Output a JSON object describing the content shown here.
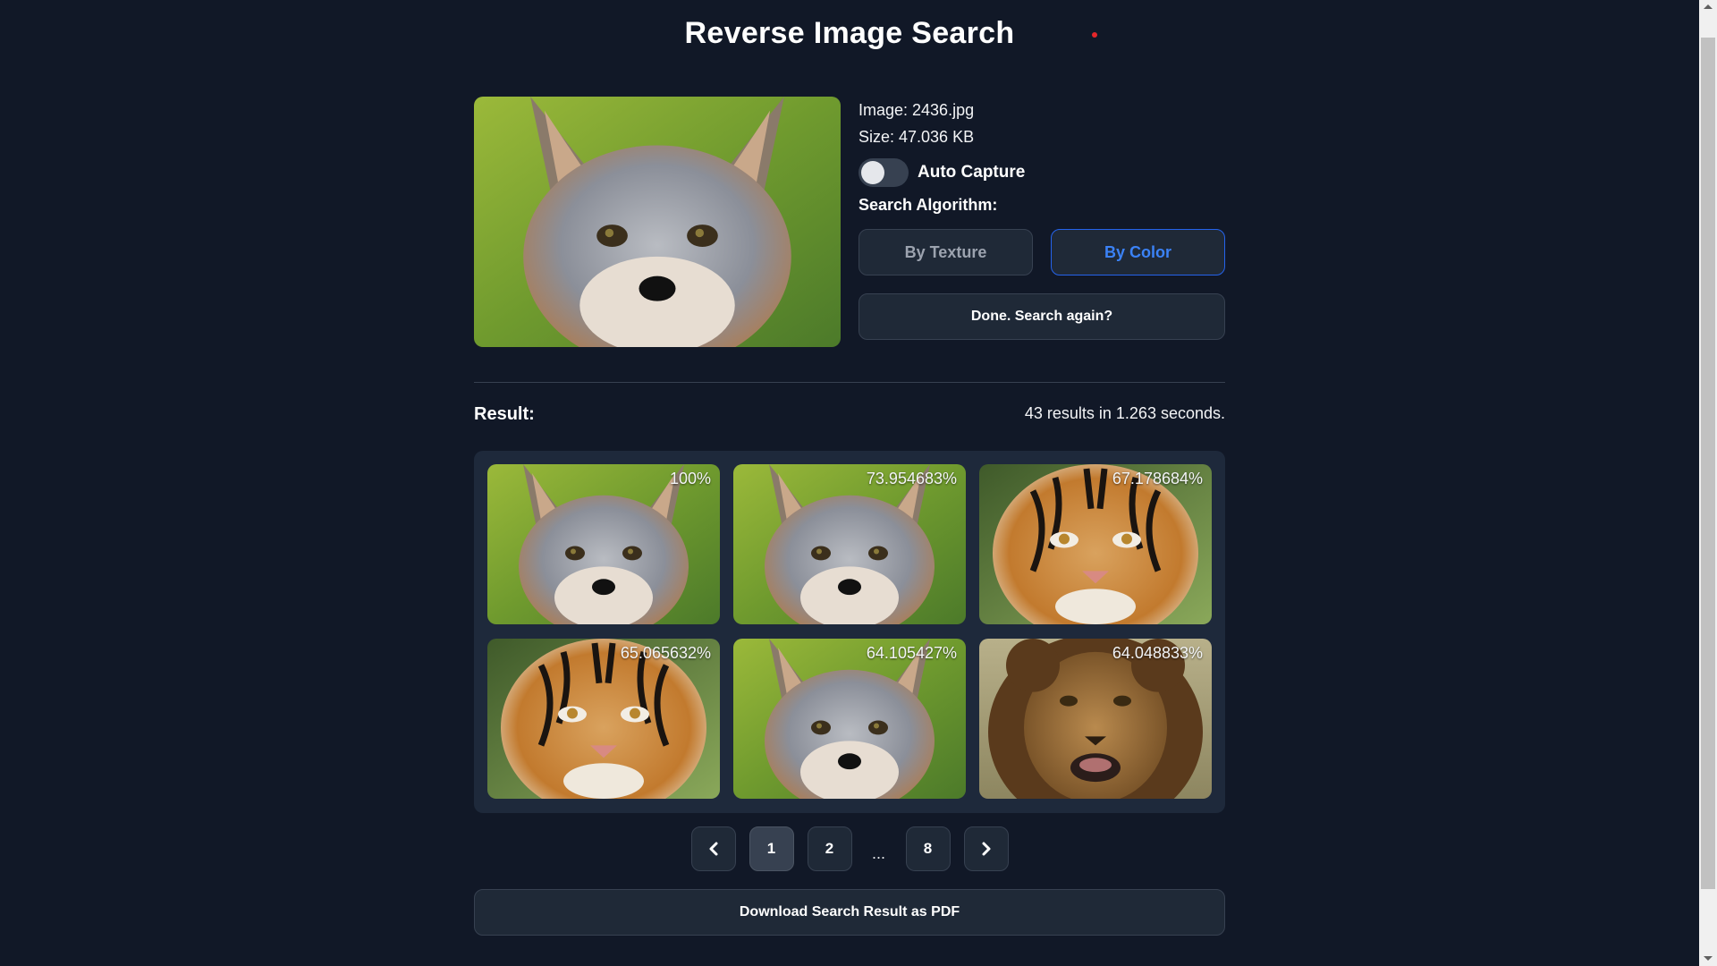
{
  "page": {
    "title": "Reverse Image Search"
  },
  "query": {
    "image_label": "Image: 2436.jpg",
    "size_label": "Size: 47.036 KB",
    "preview_subject": "fox"
  },
  "controls": {
    "auto_capture_label": "Auto Capture",
    "auto_capture_on": false,
    "algorithm_label": "Search Algorithm:",
    "algorithms": [
      {
        "label": "By Texture",
        "selected": false
      },
      {
        "label": "By Color",
        "selected": true
      }
    ],
    "search_again_label": "Done. Search again?"
  },
  "results": {
    "label": "Result:",
    "stats": "43 results in 1.263 seconds.",
    "items": [
      {
        "score": "100%",
        "subject": "fox"
      },
      {
        "score": "73.954683%",
        "subject": "fox"
      },
      {
        "score": "67.178684%",
        "subject": "tiger"
      },
      {
        "score": "65.065632%",
        "subject": "tiger"
      },
      {
        "score": "64.105427%",
        "subject": "fox"
      },
      {
        "score": "64.048833%",
        "subject": "lion"
      }
    ]
  },
  "pagination": {
    "prev_icon": "chevron-left",
    "pages": [
      "1",
      "2",
      "8"
    ],
    "current": "1",
    "ellipsis": "...",
    "next_icon": "chevron-right"
  },
  "download_label": "Download Search Result as PDF",
  "colors": {
    "background": "#111827",
    "panel": "#1e293b",
    "button": "#1f2937",
    "accent": "#3b82f6",
    "status_dot": "#e5262a"
  }
}
